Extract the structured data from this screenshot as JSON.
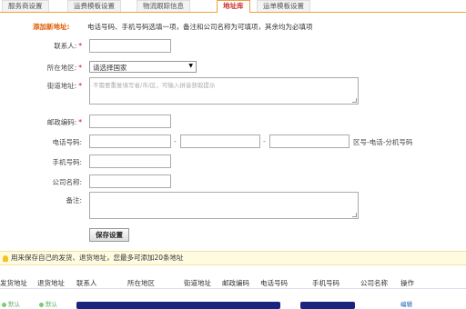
{
  "tabs": [
    {
      "label": "服务商设置"
    },
    {
      "label": "运费模板设置"
    },
    {
      "label": "物流跟踪信息"
    },
    {
      "label": "地址库"
    },
    {
      "label": "运单模板设置"
    }
  ],
  "form": {
    "title": "添加新地址:",
    "hint": "电话号码、手机号码选填一项，备注和公司名称为可填项，其余均为必填项",
    "fields": {
      "contact": {
        "label": "联系人:"
      },
      "region": {
        "label": "所在地区:",
        "selected": "请选择国家"
      },
      "street": {
        "label": "街道地址:",
        "placeholder": "不需要重复填写省/市/区，可输入拼音获取提示"
      },
      "postcode": {
        "label": "邮政编码:"
      },
      "phone": {
        "label": "电话号码:",
        "hint": "区号-电话-分机号码"
      },
      "mobile": {
        "label": "手机号码:"
      },
      "company": {
        "label": "公司名称:"
      },
      "remark": {
        "label": "备注:"
      }
    },
    "required_mark": "*",
    "dash": "-",
    "save_label": "保存设置"
  },
  "notice": "用来保存自己的发货、退货地址，您最多可添加20条地址",
  "table": {
    "headers": [
      "发货地址",
      "退货地址",
      "联系人",
      "所在地区",
      "街道地址",
      "邮政编码",
      "电话号码",
      "手机号码",
      "公司名称",
      "操作"
    ],
    "row": {
      "ship_default": "默认",
      "return_default": "默认",
      "action": "编辑"
    }
  },
  "colors": {
    "accent": "#e05a00",
    "tab_border": "#f0a040",
    "notice_bg": "#fffbe0",
    "link": "#1a5eb0"
  }
}
